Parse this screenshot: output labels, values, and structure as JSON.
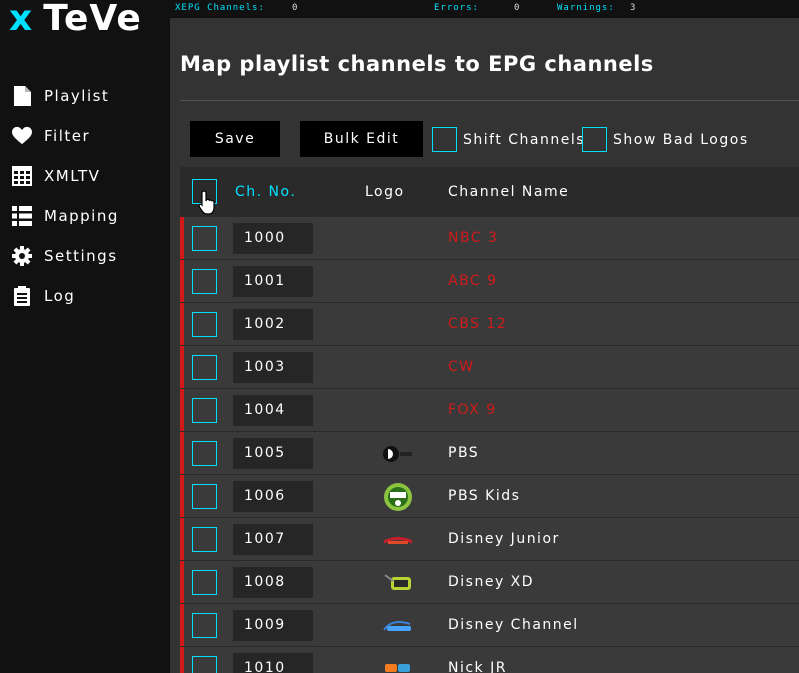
{
  "app": {
    "logo_x": "x",
    "logo_name": "TeVe"
  },
  "sidebar": {
    "items": [
      {
        "label": "Playlist",
        "icon": "file-icon"
      },
      {
        "label": "Filter",
        "icon": "heart-icon"
      },
      {
        "label": "XMLTV",
        "icon": "grid-icon"
      },
      {
        "label": "Mapping",
        "icon": "list-icon"
      },
      {
        "label": "Settings",
        "icon": "gear-icon"
      },
      {
        "label": "Log",
        "icon": "clipboard-icon"
      }
    ]
  },
  "status": {
    "xepg_label": "XEPG Channels:",
    "xepg_value": "0",
    "errors_label": "Errors:",
    "errors_value": "0",
    "warnings_label": "Warnings:",
    "warnings_value": "3"
  },
  "page": {
    "title": "Map playlist channels to EPG channels"
  },
  "toolbar": {
    "save_label": "Save",
    "bulk_edit_label": "Bulk Edit",
    "shift_channels_label": "Shift Channels",
    "show_bad_logos_label": "Show Bad Logos"
  },
  "table": {
    "headers": {
      "ch_no": "Ch. No.",
      "logo": "Logo",
      "channel_name": "Channel Name"
    },
    "rows": [
      {
        "ch_no": "1000",
        "name": "NBC 3",
        "bad": true,
        "logo": ""
      },
      {
        "ch_no": "1001",
        "name": "ABC 9",
        "bad": true,
        "logo": ""
      },
      {
        "ch_no": "1002",
        "name": "CBS 12",
        "bad": true,
        "logo": ""
      },
      {
        "ch_no": "1003",
        "name": "CW",
        "bad": true,
        "logo": ""
      },
      {
        "ch_no": "1004",
        "name": "FOX 9",
        "bad": true,
        "logo": ""
      },
      {
        "ch_no": "1005",
        "name": "PBS",
        "bad": false,
        "logo": "pbs"
      },
      {
        "ch_no": "1006",
        "name": "PBS Kids",
        "bad": false,
        "logo": "pbskids"
      },
      {
        "ch_no": "1007",
        "name": "Disney Junior",
        "bad": false,
        "logo": "disneyjr"
      },
      {
        "ch_no": "1008",
        "name": "Disney XD",
        "bad": false,
        "logo": "disneyxd"
      },
      {
        "ch_no": "1009",
        "name": "Disney Channel",
        "bad": false,
        "logo": "disney"
      },
      {
        "ch_no": "1010",
        "name": "Nick JR",
        "bad": false,
        "logo": "nickjr"
      }
    ]
  },
  "colors": {
    "accent": "#00e1ff",
    "error": "#d11a1a"
  }
}
